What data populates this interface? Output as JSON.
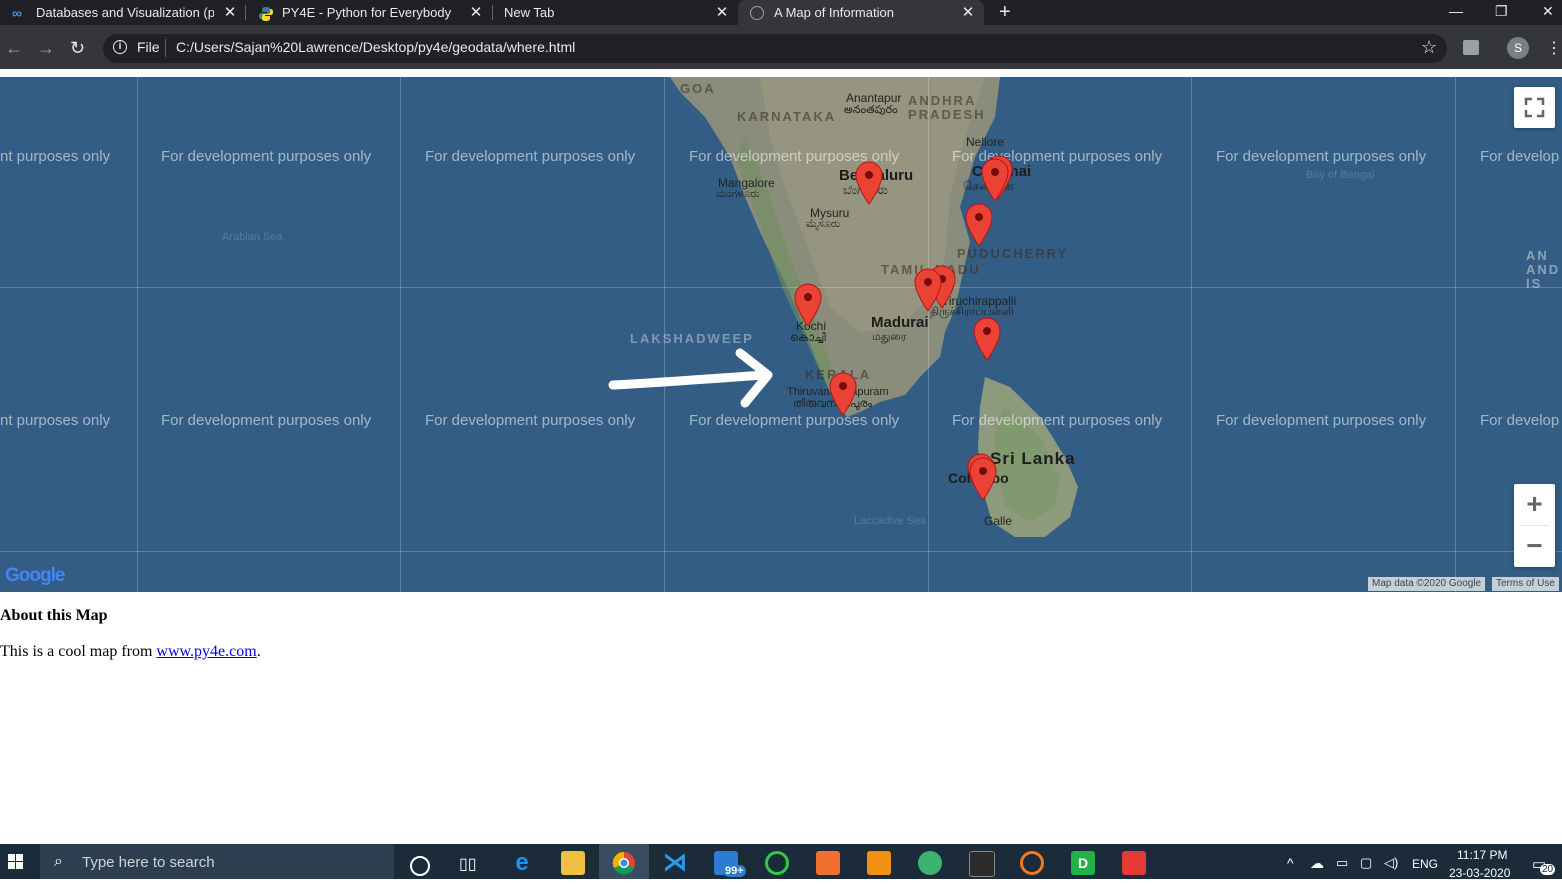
{
  "browser": {
    "tabs": [
      {
        "title": "Databases and Visualization (pee",
        "active": false
      },
      {
        "title": "PY4E - Python for Everybody",
        "active": false
      },
      {
        "title": "New Tab",
        "active": false
      },
      {
        "title": "A Map of Information",
        "active": true
      }
    ],
    "close_glyph": "✕",
    "new_tab_glyph": "+",
    "window_controls": {
      "minimize": "—",
      "restore": "❐",
      "close": "✕"
    },
    "address": {
      "scheme_label": "File",
      "url": "C:/Users/Sajan%20Lawrence/Desktop/py4e/geodata/where.html"
    },
    "profile_initial": "S"
  },
  "map": {
    "watermark": "For development purposes only",
    "partial_left": "nt purposes only",
    "partial_right": "For develop",
    "seas": [
      "Arabian Sea",
      "Bay of Bengal",
      "Laccadive Sea"
    ],
    "regions": [
      "GOA",
      "KARNATAKA",
      "ANDHRA PRADESH",
      "TAMIL NADU",
      "PUDUCHERRY",
      "LAKSHADWEEP",
      "KERALA",
      "Sri Lanka",
      "AN AND IS"
    ],
    "places": {
      "anantapur": "Anantapur",
      "anantapur_local": "అనంతపురం",
      "nellore": "Nellore",
      "mangalore": "Mangalore",
      "mangalore_local": "ಮಂಗಳೂರು",
      "bengaluru": "Bengaluru",
      "bengaluru_local": "ಬೆಂಗಳೂರು",
      "mysuru": "Mysuru",
      "mysuru_local": "ಮೈಸೂರು",
      "chennai": "Chennai",
      "chennai_local": "சென்னை",
      "tiruchirappalli": "Tiruchirappalli",
      "tiruchirappalli_local": "திருச்சிராப்பள்ளி",
      "madurai": "Madurai",
      "madurai_local": "மதுரை",
      "kochi": "Kochi",
      "kochi_local": "കൊച്ചി",
      "thiruvananthapuram": "Thiruvananthapuram",
      "thiruvananthapuram_local": "തിരുവനന്തപുരം",
      "colombo": "Colombo",
      "galle": "Galle"
    },
    "markers_count": 11,
    "controls": {
      "zoom_in": "+",
      "zoom_out": "−"
    },
    "google_logo": "Google",
    "attribution": "Map data ©2020 Google",
    "terms": "Terms of Use"
  },
  "about": {
    "heading": "About this Map",
    "text_before": "This is a cool map from ",
    "link": "www.py4e.com",
    "text_after": "."
  },
  "taskbar": {
    "search_placeholder": "Type here to search",
    "mail_badge": "99+",
    "language": "ENG",
    "time": "11:17 PM",
    "date": "23-03-2020",
    "notifications": "20"
  },
  "colors": {
    "marker": "#ea4335",
    "sea": "#335d85",
    "tab_bar": "#202124",
    "toolbar": "#35363a",
    "taskbar": "#1c2b3a"
  }
}
